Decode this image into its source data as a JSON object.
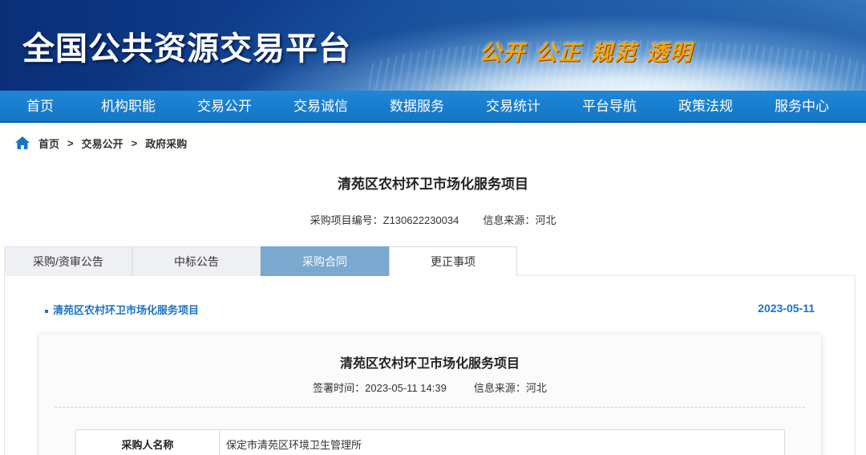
{
  "header": {
    "site_title": "全国公共资源交易平台",
    "slogan": "公开 公正 规范 透明"
  },
  "nav": {
    "items": [
      "首页",
      "机构职能",
      "交易公开",
      "交易诚信",
      "数据服务",
      "交易统计",
      "平台导航",
      "政策法规",
      "服务中心"
    ]
  },
  "breadcrumb": {
    "items": [
      "首页",
      "交易公开",
      "政府采购"
    ],
    "separator": ">"
  },
  "project": {
    "title": "清苑区农村环卫市场化服务项目",
    "code_label": "采购项目编号：Z130622230034",
    "source_label": "信息来源：河北"
  },
  "tabs": [
    {
      "label": "采购/资审公告",
      "state": "normal"
    },
    {
      "label": "中标公告",
      "state": "normal"
    },
    {
      "label": "采购合同",
      "state": "active"
    },
    {
      "label": "更正事项",
      "state": "plain"
    }
  ],
  "list_item": {
    "title": "清苑区农村环卫市场化服务项目",
    "date": "2023-05-11"
  },
  "detail": {
    "title": "清苑区农村环卫市场化服务项目",
    "sign_time": "签署时间：2023-05-11 14:39",
    "source": "信息来源：河北",
    "table": [
      {
        "label": "采购人名称",
        "value": "保定市清苑区环境卫生管理所"
      }
    ]
  },
  "colors": {
    "nav_bg": "#1a7ecf",
    "active_tab": "#7ba8cf",
    "link": "#1a73c4",
    "slogan": "#f2a413"
  }
}
